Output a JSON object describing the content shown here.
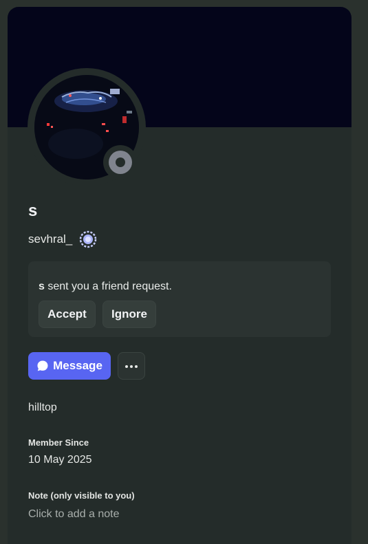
{
  "profile": {
    "display_name": "s",
    "username": "sevhral_",
    "status": "offline",
    "badge_icon": "nitro-badge-icon"
  },
  "friend_request": {
    "sender": "s",
    "text": " sent you a friend request.",
    "accept_label": "Accept",
    "ignore_label": "Ignore"
  },
  "actions": {
    "message_label": "Message",
    "more_icon": "ellipsis-icon"
  },
  "bio": "hilltop",
  "member_since": {
    "label": "Member Since",
    "value": "10 May 2025"
  },
  "note": {
    "label": "Note (only visible to you)",
    "placeholder": "Click to add a note",
    "value": ""
  },
  "colors": {
    "banner": "#04051a",
    "card": "#242c2a",
    "accent": "#5865f2",
    "status_offline": "#80848e"
  }
}
